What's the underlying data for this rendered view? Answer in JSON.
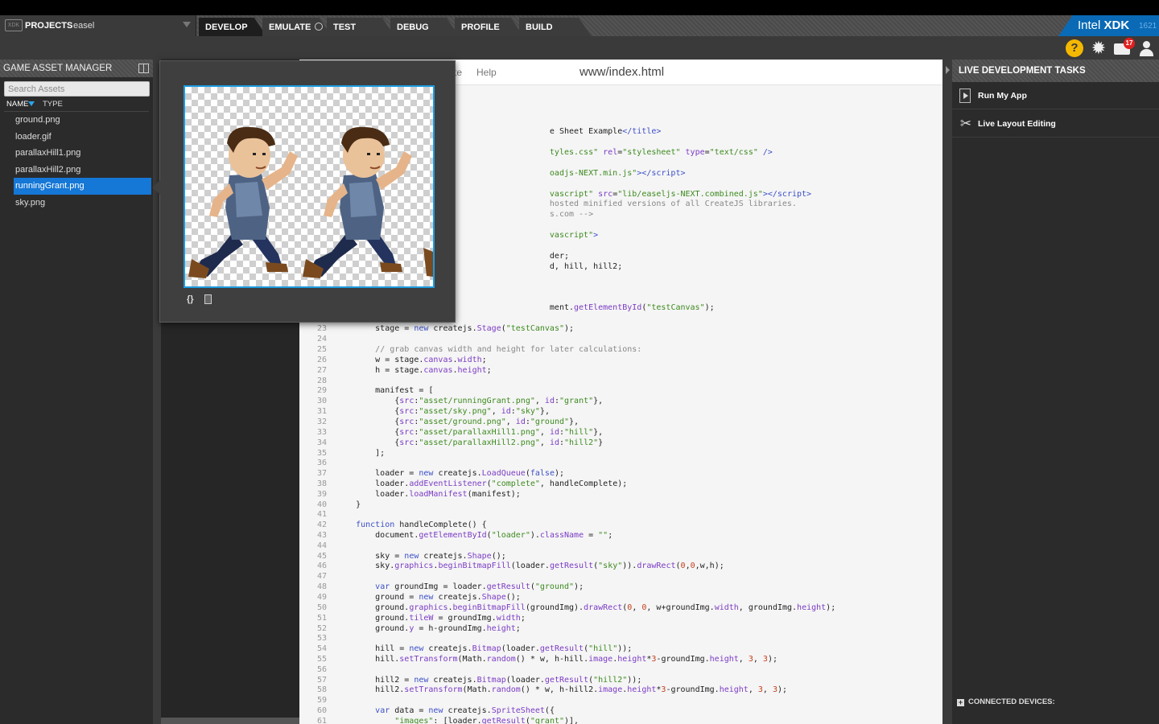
{
  "header": {
    "projects_icon": "xdk-logo-icon",
    "projects_label": "PROJECTS",
    "project_name": "easel",
    "tabs": [
      {
        "label": "DEVELOP",
        "active": true
      },
      {
        "label": "EMULATE",
        "active": false
      },
      {
        "label": "TEST",
        "active": false
      },
      {
        "label": "DEBUG",
        "active": false
      },
      {
        "label": "PROFILE",
        "active": false
      },
      {
        "label": "BUILD",
        "active": false
      }
    ],
    "brand": "Intel",
    "brand_product": "XDK",
    "brand_version": "1621"
  },
  "toolbar": {
    "help_symbol": "?",
    "notifications_badge": "17"
  },
  "asset_manager": {
    "title": "GAME ASSET MANAGER",
    "search_placeholder": "Search Assets",
    "col_name": "NAME",
    "col_type": "TYPE",
    "files": [
      "ground.png",
      "loader.gif",
      "parallaxHill1.png",
      "parallaxHill2.png",
      "runningGrant.png",
      "sky.png"
    ],
    "selected_index": 4
  },
  "editor": {
    "menu_partial": "te",
    "menu_help": "Help",
    "file_title": "www/index.html"
  },
  "preview": {
    "btn_braces": "{}"
  },
  "live_dev": {
    "title": "LIVE DEVELOPMENT TASKS",
    "tasks": [
      "Run My App",
      "Live Layout Editing"
    ],
    "connected": "CONNECTED DEVICES:"
  },
  "colors": {
    "accent": "#1577d6",
    "intel_blue": "#0a6ab5",
    "help_yellow": "#f5b800",
    "badge_red": "#e02020"
  }
}
